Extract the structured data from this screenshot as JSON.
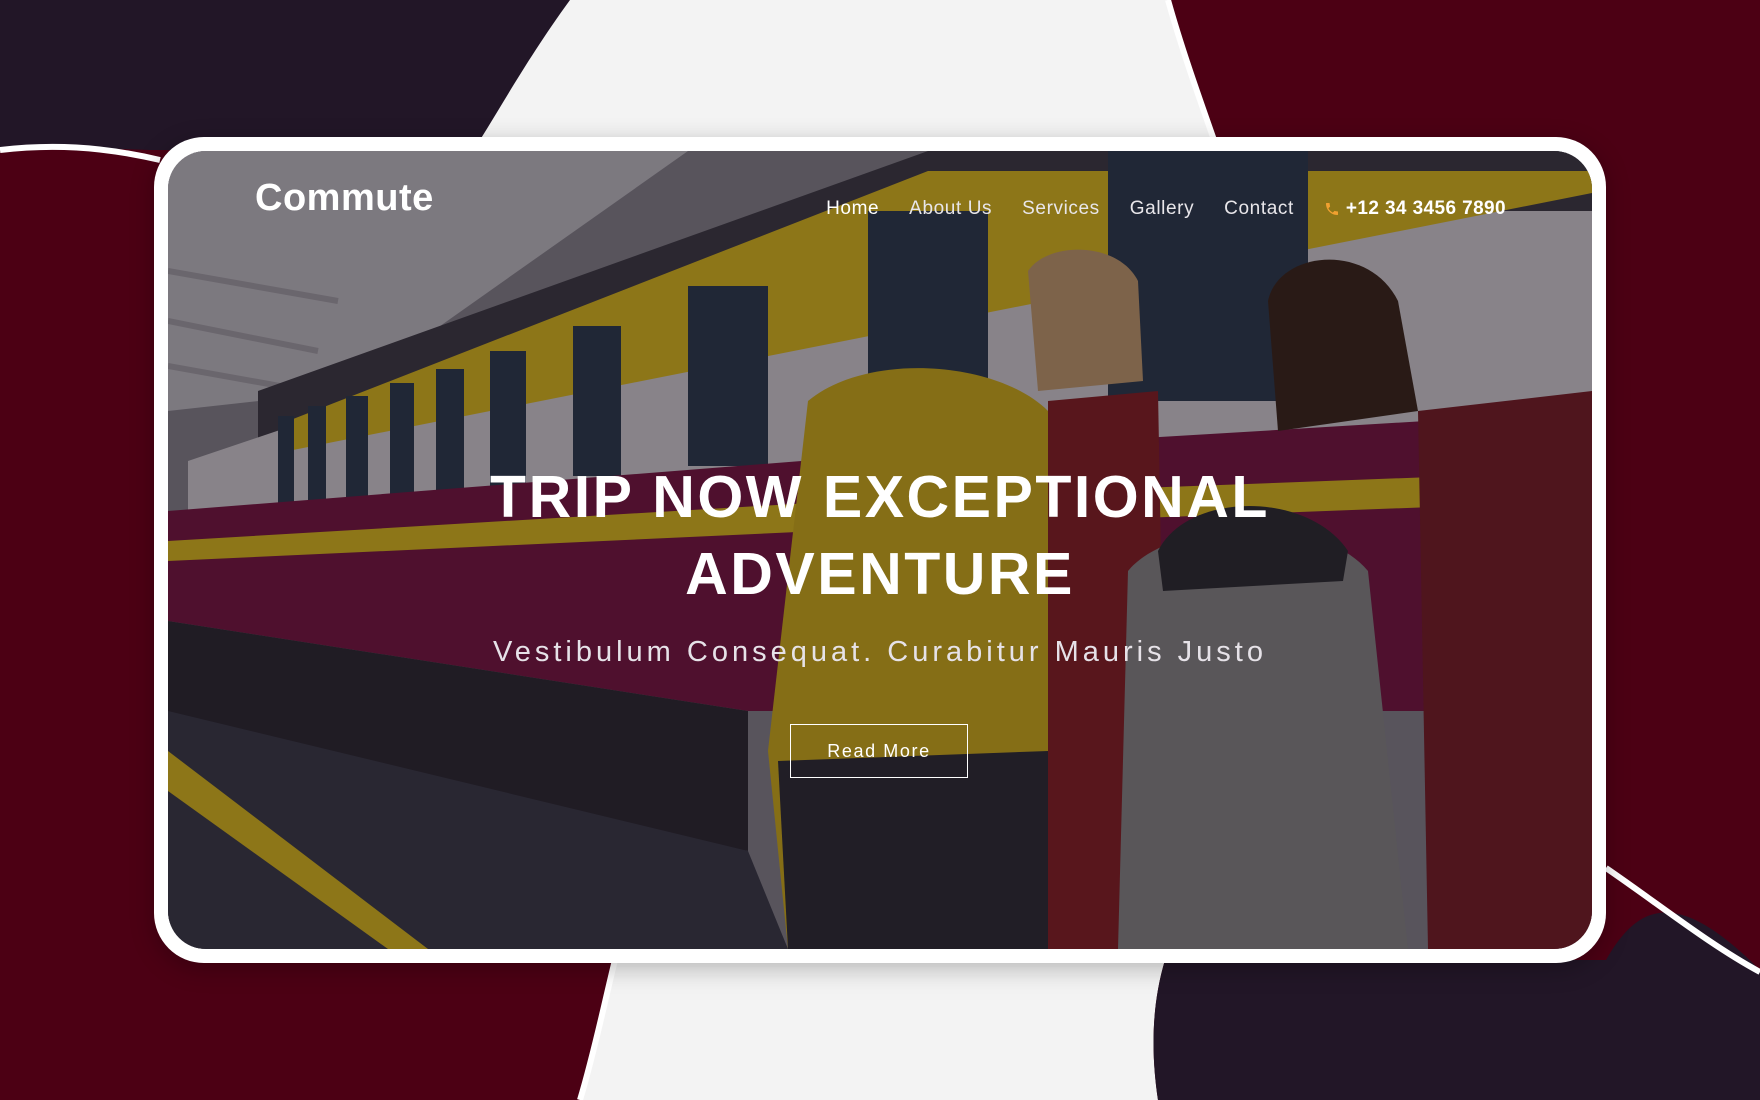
{
  "brand": {
    "name": "Commute"
  },
  "nav": {
    "items": [
      {
        "label": "Home"
      },
      {
        "label": "About Us"
      },
      {
        "label": "Services"
      },
      {
        "label": "Gallery"
      },
      {
        "label": "Contact"
      }
    ],
    "phone": "+12 34 3456 7890"
  },
  "hero": {
    "headline_line1": "TRIP NOW EXCEPTIONAL",
    "headline_line2": "ADVENTURE",
    "subtitle": "Vestibulum Consequat. Curabitur Mauris Justo",
    "cta_label": "Read More"
  },
  "colors": {
    "page_background": "#4c0014",
    "dark_blob": "#221627",
    "light_blob": "#f3f3f3",
    "accent_phone_icon": "#f0a030",
    "train_stripe_yellow": "#e6c21a",
    "train_body_magenta": "#7a1240"
  },
  "icons": {
    "phone": "phone-icon"
  }
}
